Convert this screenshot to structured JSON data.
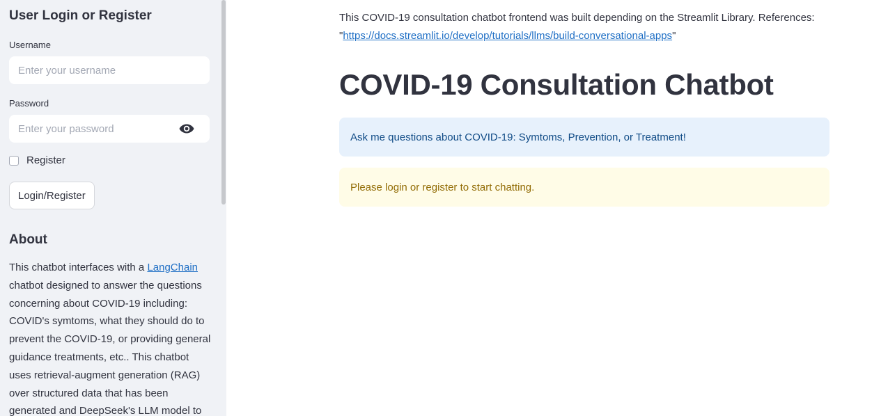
{
  "sidebar": {
    "login_title": "User Login or Register",
    "username": {
      "label": "Username",
      "placeholder": "Enter your username"
    },
    "password": {
      "label": "Password",
      "placeholder": "Enter your password",
      "toggle_icon": "eye-icon"
    },
    "register_checkbox": {
      "label": "Register",
      "checked": false
    },
    "login_button": "Login/Register",
    "about": {
      "heading": "About",
      "text_before_link": "This chatbot interfaces with a ",
      "link_text": "LangChain",
      "text_after_link": " chatbot designed to answer the questions concerning about COVID-19 including: COVID's symtoms, what they should do to prevent the COVID-19, or providing general guidance treatments, etc.. This chatbot uses retrieval-augment generation (RAG) over structured data that has been generated and DeepSeek's LLM model to"
    }
  },
  "main": {
    "intro_text": "This COVID-19 consultation chatbot frontend was built depending on the Streamlit Library. References: \"",
    "intro_link": "https://docs.streamlit.io/develop/tutorials/llms/build-conversational-apps",
    "intro_close": "\"",
    "title": "COVID-19 Consultation Chatbot",
    "info_message": "Ask me questions about COVID-19: Symtoms, Prevention, or Treatment!",
    "warning_message": "Please login or register to start chatting."
  },
  "colors": {
    "sidebar_bg": "#f0f2f6",
    "info_bg": "#e7f1fc",
    "info_text": "#104b86",
    "warning_bg": "#fffce7",
    "warning_text": "#926c05",
    "link": "#1f6fc5"
  }
}
